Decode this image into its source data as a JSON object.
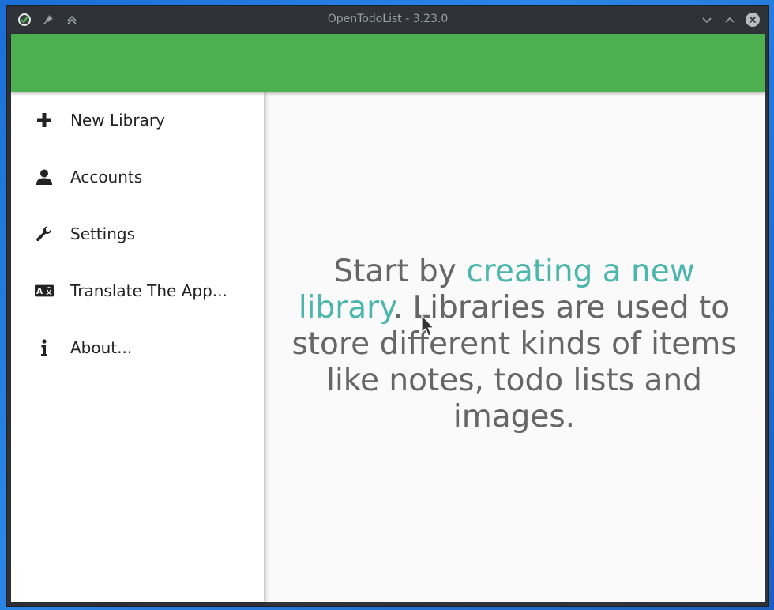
{
  "window": {
    "title": "OpenTodoList - 3.23.0"
  },
  "colors": {
    "appbar": "#4caf50",
    "link": "#4db6ac",
    "text": "#666666"
  },
  "sidebar": {
    "items": [
      {
        "label": "New Library",
        "icon": "plus-icon"
      },
      {
        "label": "Accounts",
        "icon": "person-icon"
      },
      {
        "label": "Settings",
        "icon": "wrench-icon"
      },
      {
        "label": "Translate The App...",
        "icon": "translate-icon"
      },
      {
        "label": "About...",
        "icon": "info-icon"
      }
    ]
  },
  "main": {
    "message_prefix": "Start by ",
    "message_link": "creating a new library",
    "message_suffix": ". Libraries are used to store different kinds of items like notes, todo lists and images."
  }
}
